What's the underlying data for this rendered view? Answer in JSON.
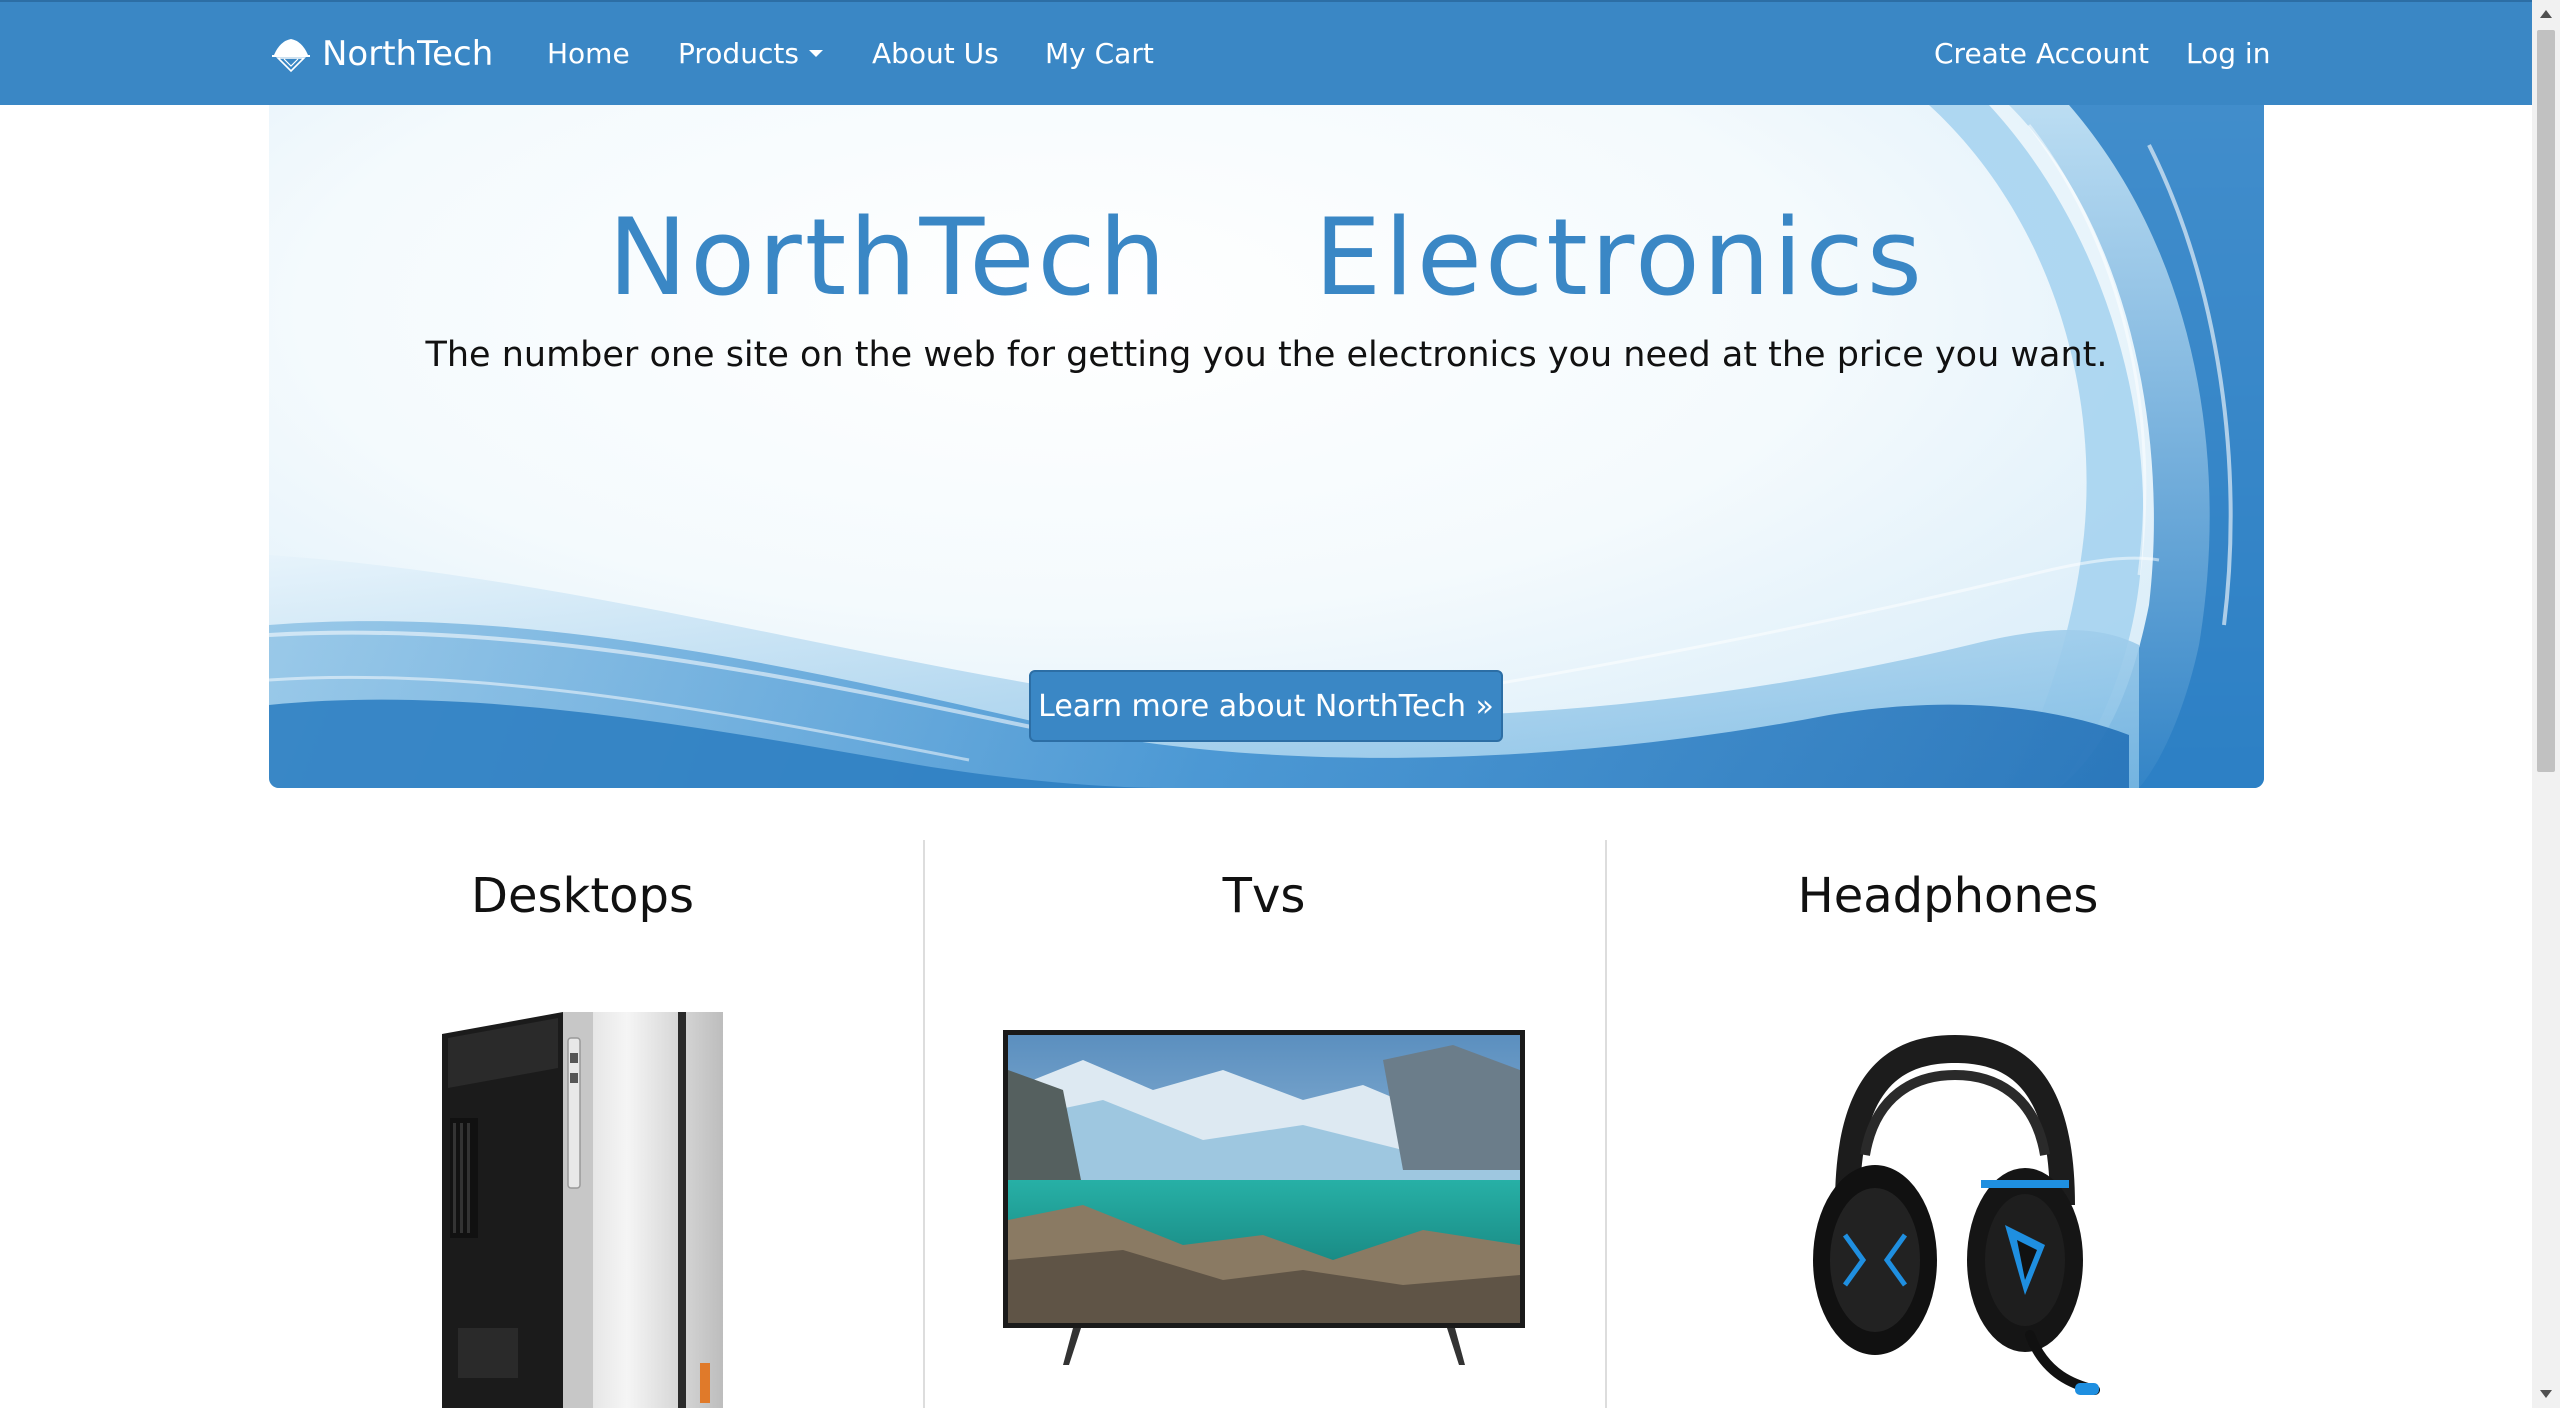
{
  "navbar": {
    "brand": "NorthTech",
    "links": {
      "home": "Home",
      "products": "Products",
      "about": "About Us",
      "cart": "My Cart",
      "create_account": "Create Account",
      "login": "Log in"
    }
  },
  "hero": {
    "title": "NorthTech  Electronics",
    "subtitle": "The number one site on the web for getting you the electronics you need at the price you want.",
    "button": "Learn more about NorthTech »"
  },
  "categories": [
    {
      "title": "Desktops",
      "image": "desktop-tower-image"
    },
    {
      "title": "Tvs",
      "image": "tv-image"
    },
    {
      "title": "Headphones",
      "image": "headphones-image"
    }
  ],
  "colors": {
    "primary": "#3a87c5",
    "primary_border": "#2c6ea5",
    "divider": "#dddddd"
  }
}
